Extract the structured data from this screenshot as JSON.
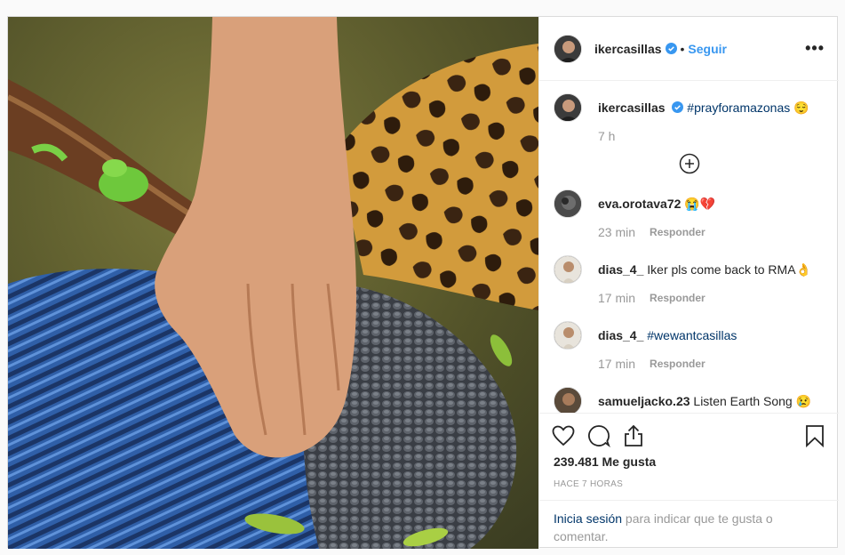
{
  "header": {
    "username": "ikercasillas",
    "separator": "•",
    "follow_label": "Seguir",
    "more_label": "•••"
  },
  "caption": {
    "username": "ikercasillas",
    "text": "#prayforamazonas 😌",
    "time": "7 h"
  },
  "comments": [
    {
      "username": "eva.orotava72",
      "text": "😭💔",
      "time": "23 min",
      "reply_label": "Responder"
    },
    {
      "username": "dias_4_",
      "text": "Iker pls come back to RMA👌",
      "time": "17 min",
      "reply_label": "Responder"
    },
    {
      "username": "dias_4_",
      "text": "#wewantcasillas",
      "time": "17 min",
      "reply_label": "Responder"
    },
    {
      "username": "samueljacko.23",
      "text": "Listen Earth Song 😢",
      "time": "",
      "reply_label": ""
    }
  ],
  "likes": "239.481 Me gusta",
  "timestamp": "HACE 7 HORAS",
  "login": {
    "link": "Inicia sesión",
    "text": " para indicar que te gusta o comentar."
  },
  "colors": {
    "link_blue": "#3897f0",
    "hashtag": "#003569",
    "muted": "#999999"
  }
}
